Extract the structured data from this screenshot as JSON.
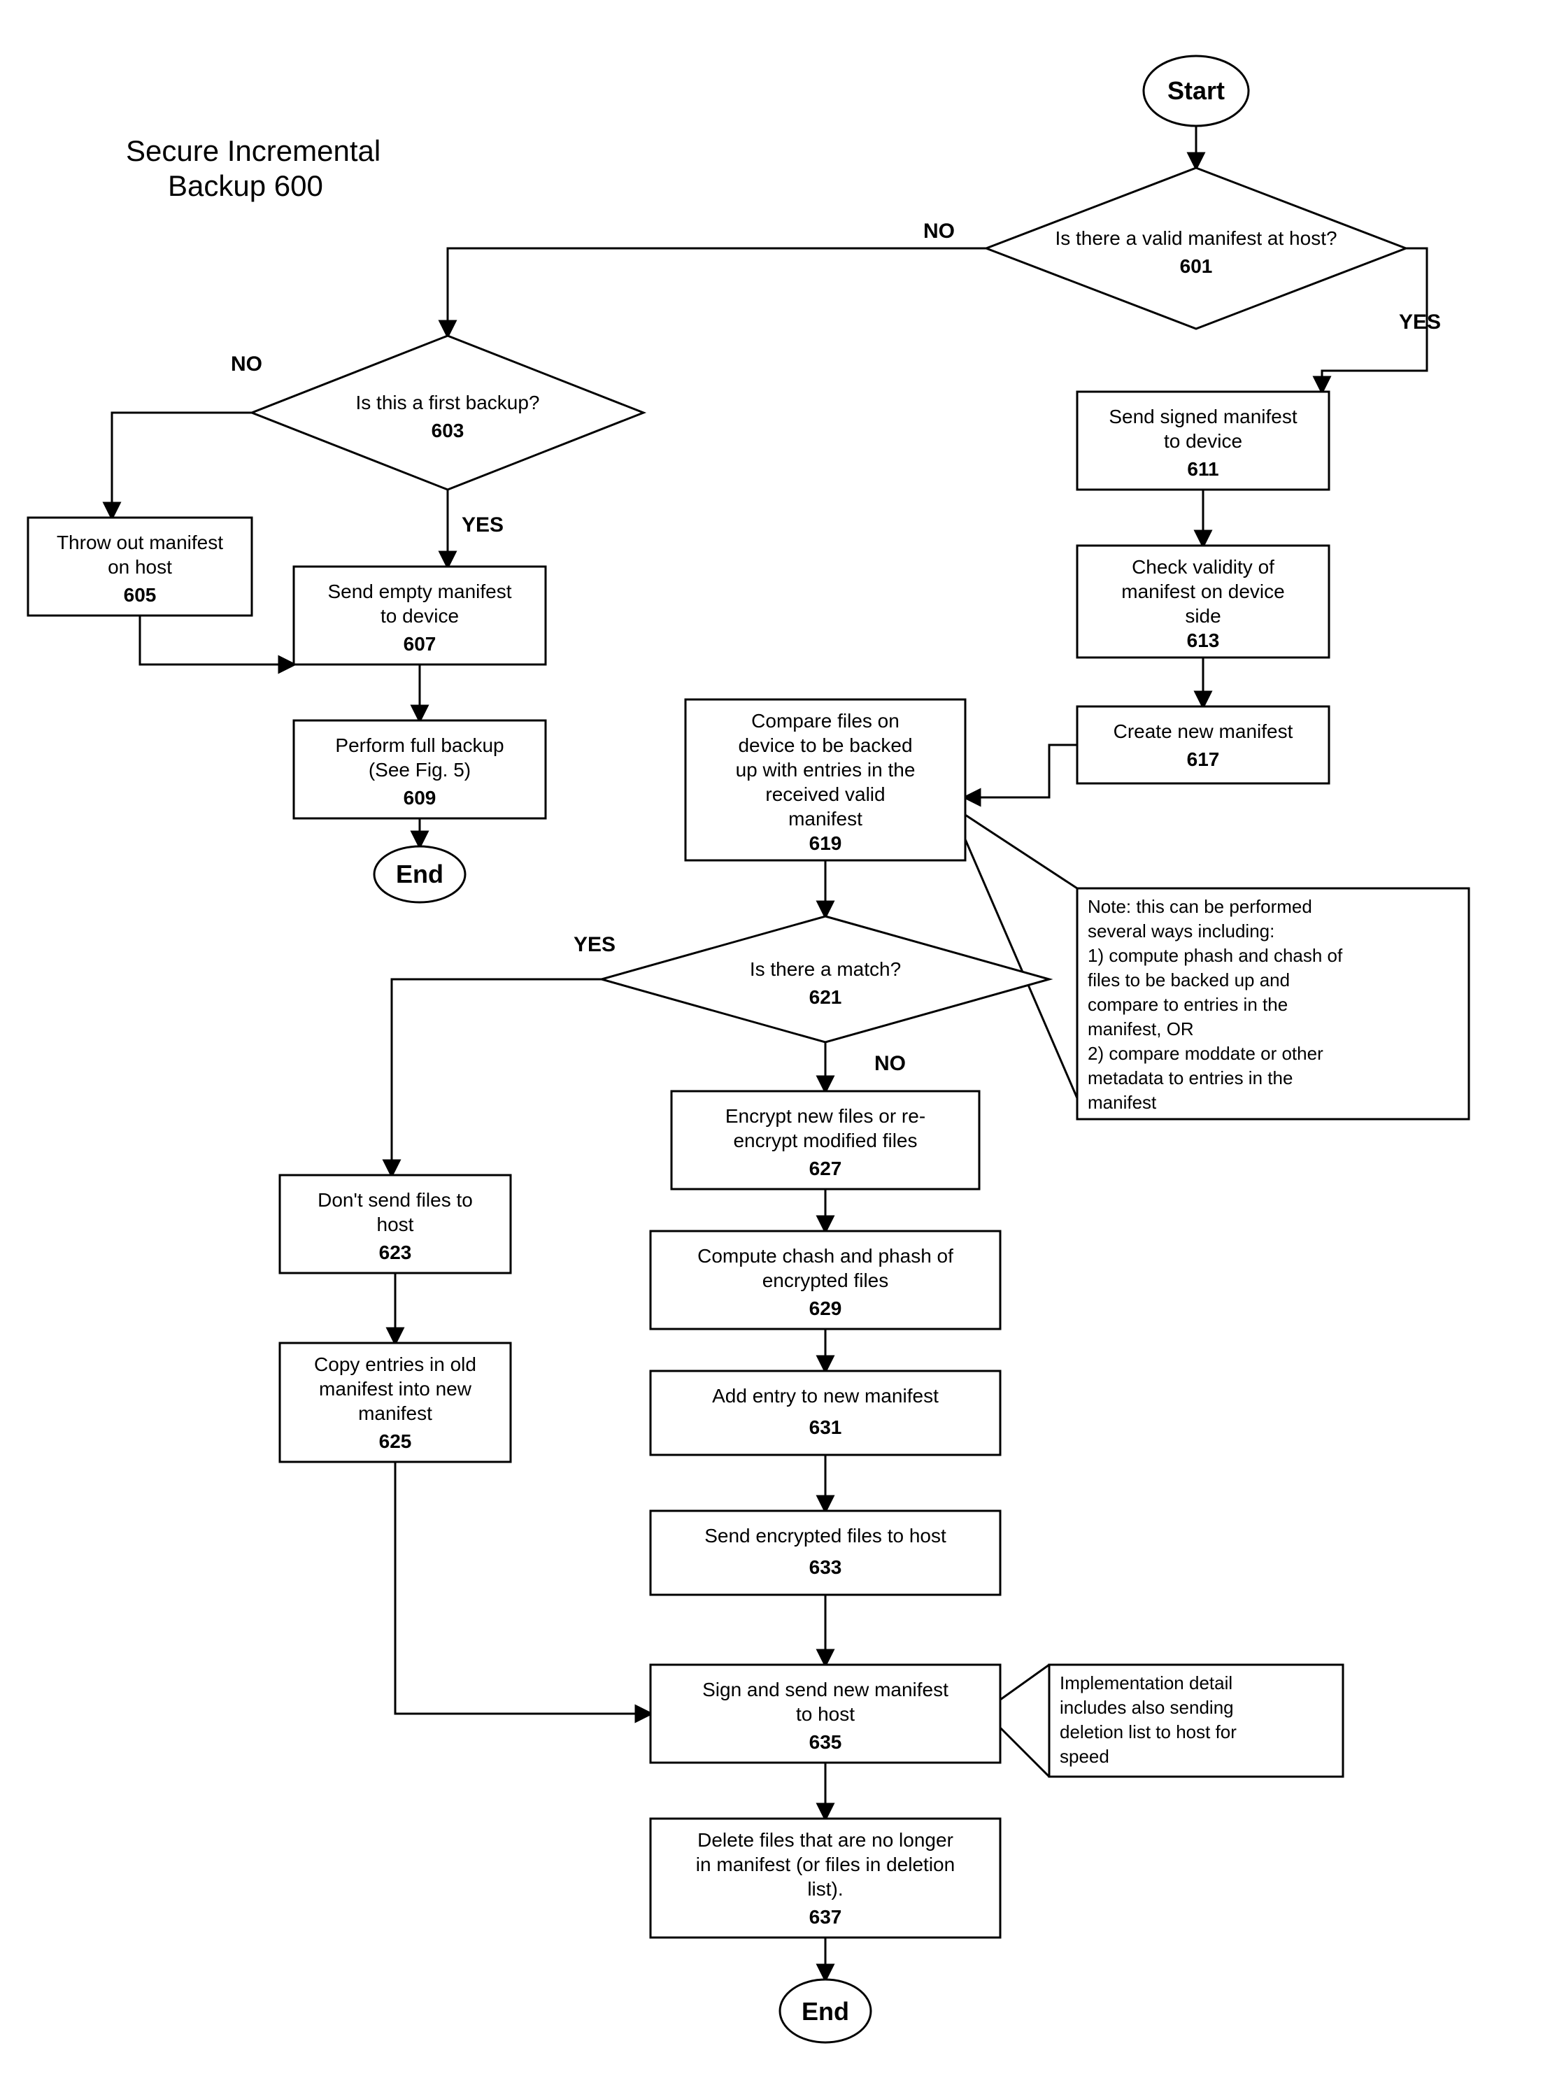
{
  "title_l1": "Secure Incremental",
  "title_l2": "Backup 600",
  "terminals": {
    "start": "Start",
    "end": "End"
  },
  "labels": {
    "yes": "YES",
    "no": "NO"
  },
  "n601": {
    "text": "Is there a valid manifest at host?",
    "num": "601"
  },
  "n603": {
    "text": "Is this a first backup?",
    "num": "603"
  },
  "n605": {
    "l1": "Throw out manifest",
    "l2": "on host",
    "num": "605"
  },
  "n607": {
    "l1": "Send empty manifest",
    "l2": "to device",
    "num": "607"
  },
  "n609": {
    "l1": "Perform full backup",
    "l2": "(See Fig. 5)",
    "num": "609"
  },
  "n611": {
    "l1": "Send signed manifest",
    "l2": "to device",
    "num": "611"
  },
  "n613": {
    "l1": "Check validity of",
    "l2": "manifest on device",
    "l3": "side",
    "num": "613"
  },
  "n617": {
    "l1": "Create new manifest",
    "num": "617"
  },
  "n619": {
    "l1": "Compare files on",
    "l2": "device to be backed",
    "l3": "up with entries in the",
    "l4": "received valid",
    "l5": "manifest",
    "num": "619"
  },
  "n621": {
    "text": "Is there a match?",
    "num": "621"
  },
  "n623": {
    "l1": "Don't send files to",
    "l2": "host",
    "num": "623"
  },
  "n625": {
    "l1": "Copy entries in old",
    "l2": "manifest into new",
    "l3": "manifest",
    "num": "625"
  },
  "n627": {
    "l1": "Encrypt new files or re-",
    "l2": "encrypt modified files",
    "num": "627"
  },
  "n629": {
    "l1": "Compute chash and phash of",
    "l2": "encrypted files",
    "num": "629"
  },
  "n631": {
    "l1": "Add entry to new manifest",
    "num": "631"
  },
  "n633": {
    "l1": "Send encrypted files to host",
    "num": "633"
  },
  "n635": {
    "l1": "Sign and send new manifest",
    "l2": "to host",
    "num": "635"
  },
  "n637": {
    "l1": "Delete files that are no longer",
    "l2": "in manifest (or files in deletion",
    "l3": "list).",
    "num": "637"
  },
  "note619": {
    "l1": "Note: this can be performed",
    "l2": "several ways including:",
    "l3": "1) compute phash and chash of",
    "l4": "files to be backed up and",
    "l5": "compare to entries in the",
    "l6": "manifest, OR",
    "l7": "2) compare moddate or other",
    "l8": "metadata to entries in the",
    "l9": "manifest"
  },
  "note635": {
    "l1": "Implementation detail",
    "l2": "includes also sending",
    "l3": "deletion list to host for",
    "l4": "speed"
  }
}
